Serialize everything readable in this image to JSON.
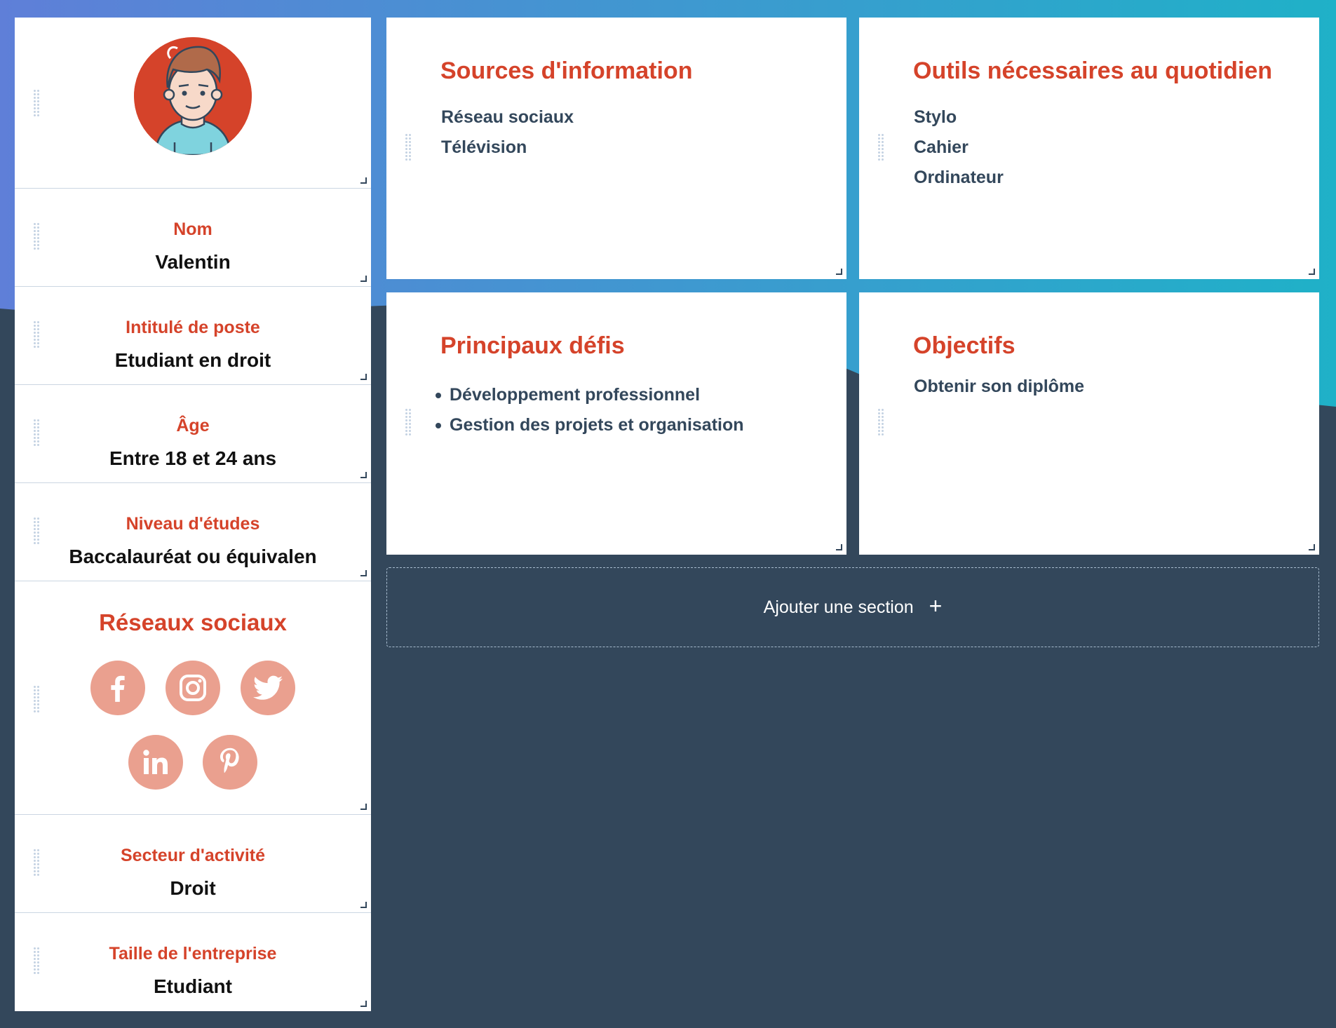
{
  "colors": {
    "accent": "#d5432a",
    "social_icon_bg": "#eaa08f",
    "dark_bg": "#33475b",
    "gradient_start": "#5f7fd8",
    "gradient_end": "#1fb1c8"
  },
  "avatar": {
    "icon": "avatar-icon"
  },
  "fields": [
    {
      "label": "Nom",
      "value": "Valentin"
    },
    {
      "label": "Intitulé de poste",
      "value": "Etudiant en droit"
    },
    {
      "label": "Âge",
      "value": "Entre 18 et 24 ans"
    },
    {
      "label": "Niveau d'études",
      "value": "Baccalauréat ou équivalen"
    }
  ],
  "social": {
    "title": "Réseaux sociaux",
    "icons": [
      "facebook-icon",
      "instagram-icon",
      "twitter-icon",
      "linkedin-icon",
      "pinterest-icon"
    ]
  },
  "fields_bottom": [
    {
      "label": "Secteur d'activité",
      "value": "Droit"
    },
    {
      "label": "Taille de l'entreprise",
      "value": "Etudiant"
    }
  ],
  "panels": {
    "sources": {
      "title": "Sources d'information",
      "items": [
        "Réseau sociaux",
        "Télévision"
      ]
    },
    "outils": {
      "title": "Outils nécessaires au quotidien",
      "items": [
        "Stylo",
        "Cahier",
        "Ordinateur"
      ]
    },
    "defis": {
      "title": "Principaux défis",
      "items": [
        "Développement professionnel",
        "Gestion des projets et organisation"
      ]
    },
    "objectifs": {
      "title": "Objectifs",
      "items": [
        "Obtenir son diplôme"
      ]
    }
  },
  "add_section": {
    "label": "Ajouter une section"
  }
}
